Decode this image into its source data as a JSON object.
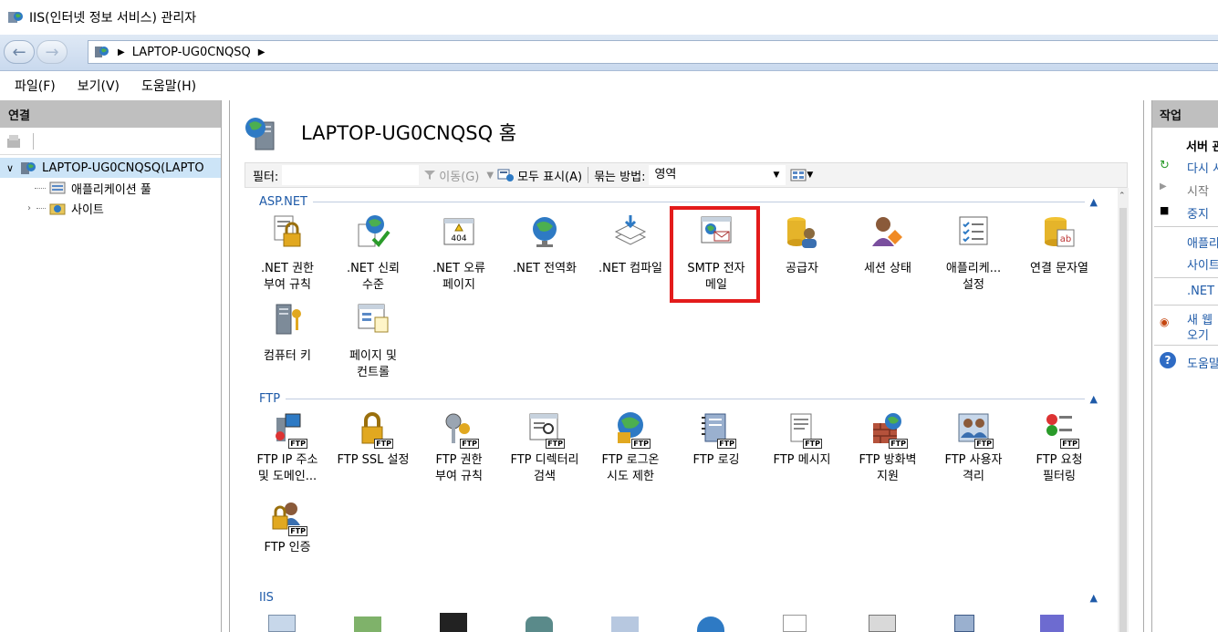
{
  "window": {
    "title": "IIS(인터넷 정보 서비스) 관리자"
  },
  "address": {
    "node": "LAPTOP-UG0CNQSQ"
  },
  "menu": [
    "파일(F)",
    "보기(V)",
    "도움말(H)"
  ],
  "connections": {
    "title": "연결",
    "tree": [
      {
        "label": "LAPTOP-UG0CNQSQ(LAPTO",
        "level": 0
      },
      {
        "label": "애플리케이션 풀",
        "level": 1
      },
      {
        "label": "사이트",
        "level": 1
      }
    ]
  },
  "home": {
    "title": "LAPTOP-UG0CNQSQ 홈"
  },
  "filter": {
    "label": "필터:",
    "go": "이동(G)",
    "show_all": "모두 표시(A)",
    "group_label": "묶는 방법:",
    "group_value": "영역"
  },
  "groups": {
    "aspnet": {
      "name": "ASP.NET"
    },
    "ftp": {
      "name": "FTP"
    },
    "iis": {
      "name": "IIS"
    }
  },
  "aspnet_tiles": [
    {
      "l1": ".NET 권한",
      "l2": "부여 규칙",
      "icon": "lock-doc-icon"
    },
    {
      "l1": ".NET 신뢰",
      "l2": "수준",
      "icon": "trust-check-icon"
    },
    {
      "l1": ".NET 오류",
      "l2": "페이지",
      "icon": "error-404-icon"
    },
    {
      "l1": ".NET 전역화",
      "l2": "",
      "icon": "globe-icon"
    },
    {
      "l1": ".NET 컴파일",
      "l2": "",
      "icon": "compile-stack-icon"
    },
    {
      "l1": "SMTP 전자",
      "l2": "메일",
      "icon": "smtp-mail-icon"
    },
    {
      "l1": "공급자",
      "l2": "",
      "icon": "provider-icon"
    },
    {
      "l1": "세션 상태",
      "l2": "",
      "icon": "session-user-icon"
    },
    {
      "l1": "애플리케...",
      "l2": "설정",
      "icon": "app-settings-icon"
    },
    {
      "l1": "연결 문자열",
      "l2": "",
      "icon": "connection-string-icon"
    },
    {
      "l1": "컴퓨터 키",
      "l2": "",
      "icon": "machine-key-icon"
    },
    {
      "l1": "페이지 및",
      "l2": "컨트롤",
      "icon": "pages-controls-icon"
    }
  ],
  "ftp_tiles": [
    {
      "l1": "FTP IP 주소",
      "l2": "및 도메인...",
      "icon": "ftp-ip-icon"
    },
    {
      "l1": "FTP SSL 설정",
      "l2": "",
      "icon": "ftp-ssl-icon"
    },
    {
      "l1": "FTP 권한",
      "l2": "부여 규칙",
      "icon": "ftp-auth-rules-icon"
    },
    {
      "l1": "FTP 디렉터리",
      "l2": "검색",
      "icon": "ftp-dir-browse-icon"
    },
    {
      "l1": "FTP 로그온",
      "l2": "시도 제한",
      "icon": "ftp-logon-icon"
    },
    {
      "l1": "FTP 로깅",
      "l2": "",
      "icon": "ftp-logging-icon"
    },
    {
      "l1": "FTP 메시지",
      "l2": "",
      "icon": "ftp-message-icon"
    },
    {
      "l1": "FTP 방화벽",
      "l2": "지원",
      "icon": "ftp-firewall-icon"
    },
    {
      "l1": "FTP 사용자",
      "l2": "격리",
      "icon": "ftp-user-isolation-icon"
    },
    {
      "l1": "FTP 요청",
      "l2": "필터링",
      "icon": "ftp-request-filter-icon"
    },
    {
      "l1": "FTP 인증",
      "l2": "",
      "icon": "ftp-authentication-icon"
    }
  ],
  "actions": {
    "title": "작업",
    "server_head": "서버 관",
    "restart": "다시 시",
    "start": "시작",
    "stop": "중지",
    "app_pools": "애플리",
    "sites": "사이트",
    "net": ".NET",
    "new_web": "새 웹",
    "get": "오기",
    "help": "도움말"
  }
}
